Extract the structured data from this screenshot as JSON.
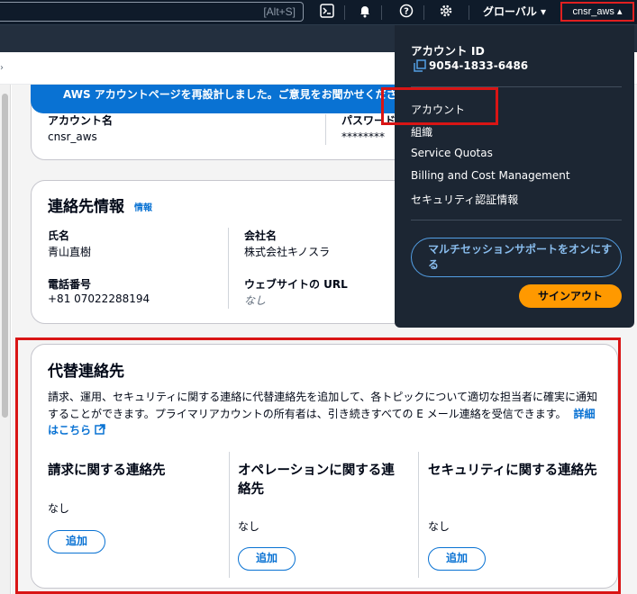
{
  "topnav": {
    "search_shortcut": "[Alt+S]",
    "region_label": "グローバル ▾",
    "account_label": "cnsr_aws ▴"
  },
  "banner": {
    "text": "AWS アカウントページを再設計しました。ご意見をお聞かせください"
  },
  "account_card": {
    "name_label": "アカウント名",
    "name_value": "cnsr_aws",
    "password_label": "パスワード",
    "password_value": "********"
  },
  "contact_card": {
    "title": "連絡先情報",
    "info_link": "情報",
    "fields": {
      "name_label": "氏名",
      "name_value": "青山直樹",
      "company_label": "会社名",
      "company_value": "株式会社キノスラ",
      "phone_label": "電話番号",
      "phone_value": "+81 07022288194",
      "website_label": "ウェブサイトの URL",
      "website_value": "なし"
    }
  },
  "alternate_card": {
    "title": "代替連絡先",
    "description": "請求、運用、セキュリティに関する連絡に代替連絡先を追加して、各トピックについて適切な担当者に確実に通知することができます。プライマリアカウントの所有者は、引き続きすべての E メール連絡を受信できます。",
    "learn_more": "詳細はこちら",
    "columns": [
      {
        "title": "請求に関する連絡先",
        "value": "なし",
        "button": "追加"
      },
      {
        "title": "オペレーションに関する連絡先",
        "value": "なし",
        "button": "追加"
      },
      {
        "title": "セキュリティに関する連絡先",
        "value": "なし",
        "button": "追加"
      }
    ]
  },
  "dropdown": {
    "account_id_label": "アカウント ID",
    "account_id": "9054-1833-6486",
    "items": [
      "アカウント",
      "組織",
      "Service Quotas",
      "Billing and Cost Management",
      "セキュリティ認証情報"
    ],
    "multisession_button": "マルチセッションサポートをオンにする",
    "signout_button": "サインアウト"
  },
  "colors": {
    "nav_bg": "#0f1b2a",
    "dropdown_bg": "#1c2633",
    "link_blue": "#0972d3",
    "signout_orange": "#ff9900",
    "highlight_red": "#d91515"
  }
}
